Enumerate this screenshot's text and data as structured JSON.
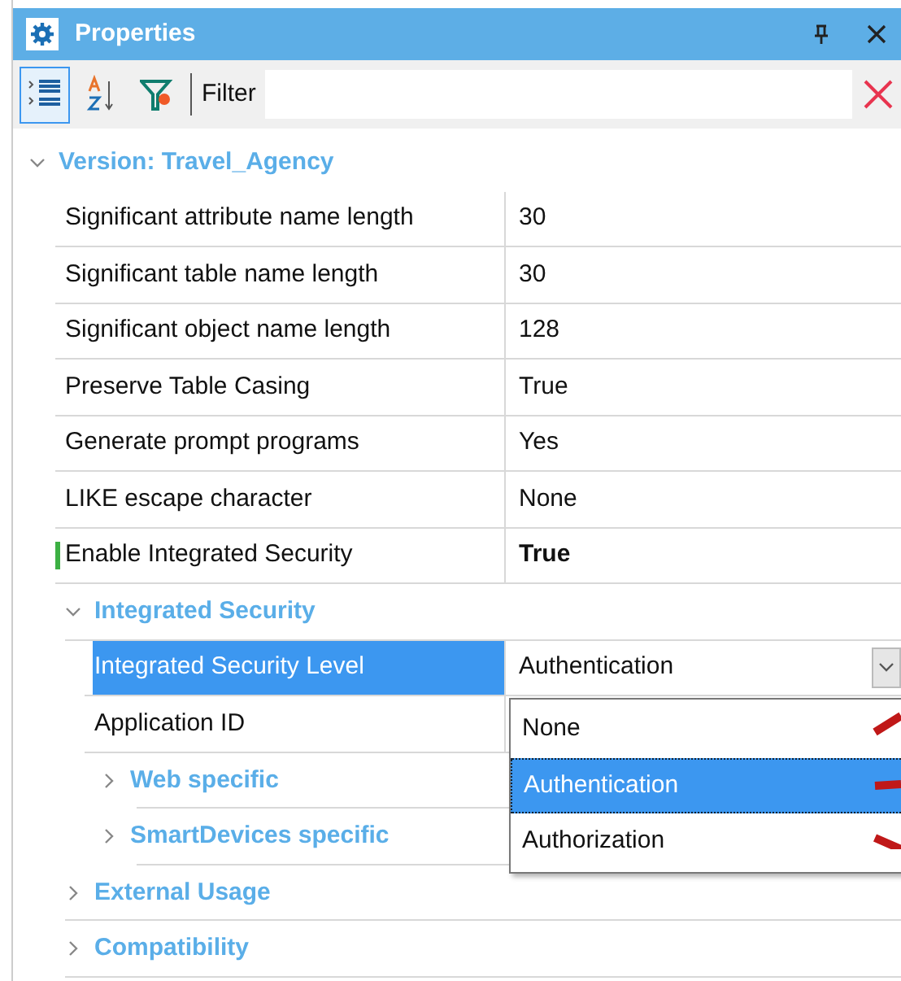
{
  "window": {
    "title": "Properties"
  },
  "toolbar": {
    "categorized_selected": true,
    "sorted_selected": false,
    "filter_label": "Filter"
  },
  "tree": [
    {
      "kind": "group",
      "label": "Version: Travel_Agency",
      "expanded": true,
      "children": [
        {
          "kind": "property",
          "label": "Significant attribute name length",
          "value": "30",
          "modified": false,
          "selected": false
        },
        {
          "kind": "property",
          "label": "Significant table name length",
          "value": "30",
          "modified": false,
          "selected": false
        },
        {
          "kind": "property",
          "label": "Significant object name length",
          "value": "128",
          "modified": false,
          "selected": false
        },
        {
          "kind": "property",
          "label": "Preserve Table Casing",
          "value": "True",
          "modified": false,
          "selected": false
        },
        {
          "kind": "property",
          "label": "Generate prompt programs",
          "value": "Yes",
          "modified": false,
          "selected": false
        },
        {
          "kind": "property",
          "label": "LIKE escape character",
          "value": "None",
          "modified": false,
          "selected": false
        },
        {
          "kind": "property",
          "label": "Enable Integrated Security",
          "value": "True",
          "modified": true,
          "selected": false
        },
        {
          "kind": "group",
          "label": "Integrated Security",
          "expanded": true,
          "children": [
            {
              "kind": "property",
              "label": "Integrated Security Level",
              "value": "Authentication",
              "modified": false,
              "selected": true,
              "dropdown": {
                "options": [
                  {
                    "label": "None",
                    "selected": false
                  },
                  {
                    "label": "Authentication",
                    "selected": true
                  },
                  {
                    "label": "Authorization",
                    "selected": false
                  }
                ]
              }
            },
            {
              "kind": "property",
              "label": "Application ID",
              "modified": false,
              "selected": false
            },
            {
              "kind": "group",
              "label": "Web specific",
              "expanded": false
            },
            {
              "kind": "group",
              "label": "SmartDevices specific",
              "expanded": false
            }
          ]
        },
        {
          "kind": "group",
          "label": "External Usage",
          "expanded": false
        },
        {
          "kind": "group",
          "label": "Compatibility",
          "expanded": false
        }
      ]
    }
  ]
}
